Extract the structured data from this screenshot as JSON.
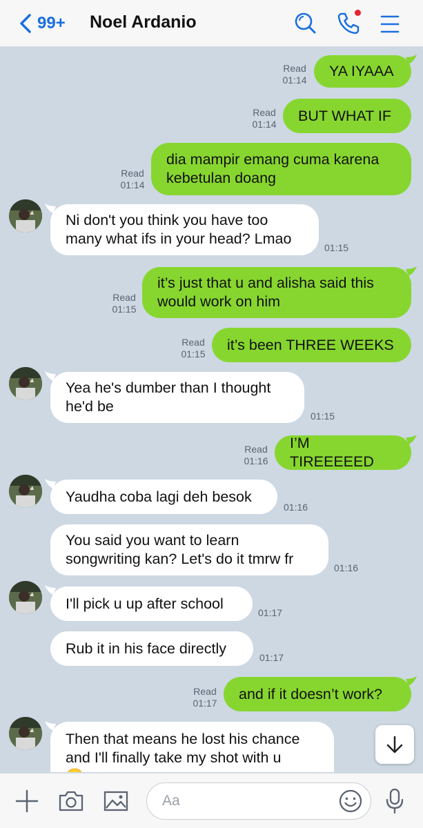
{
  "header": {
    "back_count": "99+",
    "contact_name": "Noel Ardanio",
    "colors": {
      "accent": "#1a6fe0",
      "notification": "#e8232b"
    }
  },
  "colors": {
    "sent_bubble": "#87d62f",
    "received_bubble": "#ffffff",
    "background": "#cdd8e3"
  },
  "messages": [
    {
      "direction": "sent",
      "text": "YA IYAAA",
      "status": "Read",
      "time": "01:14"
    },
    {
      "direction": "sent",
      "text": "BUT WHAT IF",
      "status": "Read",
      "time": "01:14"
    },
    {
      "direction": "sent",
      "text": "dia mampir emang cuma karena\nkebetulan doang",
      "status": "Read",
      "time": "01:14"
    },
    {
      "direction": "received",
      "text": "Ni don't you think you have too\nmany what ifs in your head? Lmao",
      "time": "01:15"
    },
    {
      "direction": "sent",
      "text": "it’s just that u and alisha said this\nwould work on him",
      "status": "Read",
      "time": "01:15"
    },
    {
      "direction": "sent",
      "text": "it’s been THREE WEEKS",
      "status": "Read",
      "time": "01:15"
    },
    {
      "direction": "received",
      "text": "Yea he's dumber than I thought\nhe'd be",
      "time": "01:15"
    },
    {
      "direction": "sent",
      "text": "I’M TIREEEEED",
      "status": "Read",
      "time": "01:16"
    },
    {
      "direction": "received",
      "text": "Yaudha coba lagi deh besok",
      "time": "01:16"
    },
    {
      "direction": "received",
      "text": "You said you want to learn\nsongwriting kan? Let's do it tmrw fr",
      "time": "01:16"
    },
    {
      "direction": "received",
      "text": "I'll pick u up after school",
      "time": "01:17"
    },
    {
      "direction": "received",
      "text": "Rub it in his face directly",
      "time": "01:17"
    },
    {
      "direction": "sent",
      "text": "and if it doesn’t work?",
      "status": "Read",
      "time": "01:17"
    },
    {
      "direction": "received",
      "text": "Then that means he lost his chance\nand I'll finally take my shot with u\n😊"
    }
  ],
  "composer": {
    "placeholder": "Aa",
    "icons": [
      "plus-icon",
      "camera-icon",
      "image-icon",
      "emoji-icon",
      "microphone-icon"
    ]
  },
  "scroll_button_icon": "arrow-down-icon"
}
